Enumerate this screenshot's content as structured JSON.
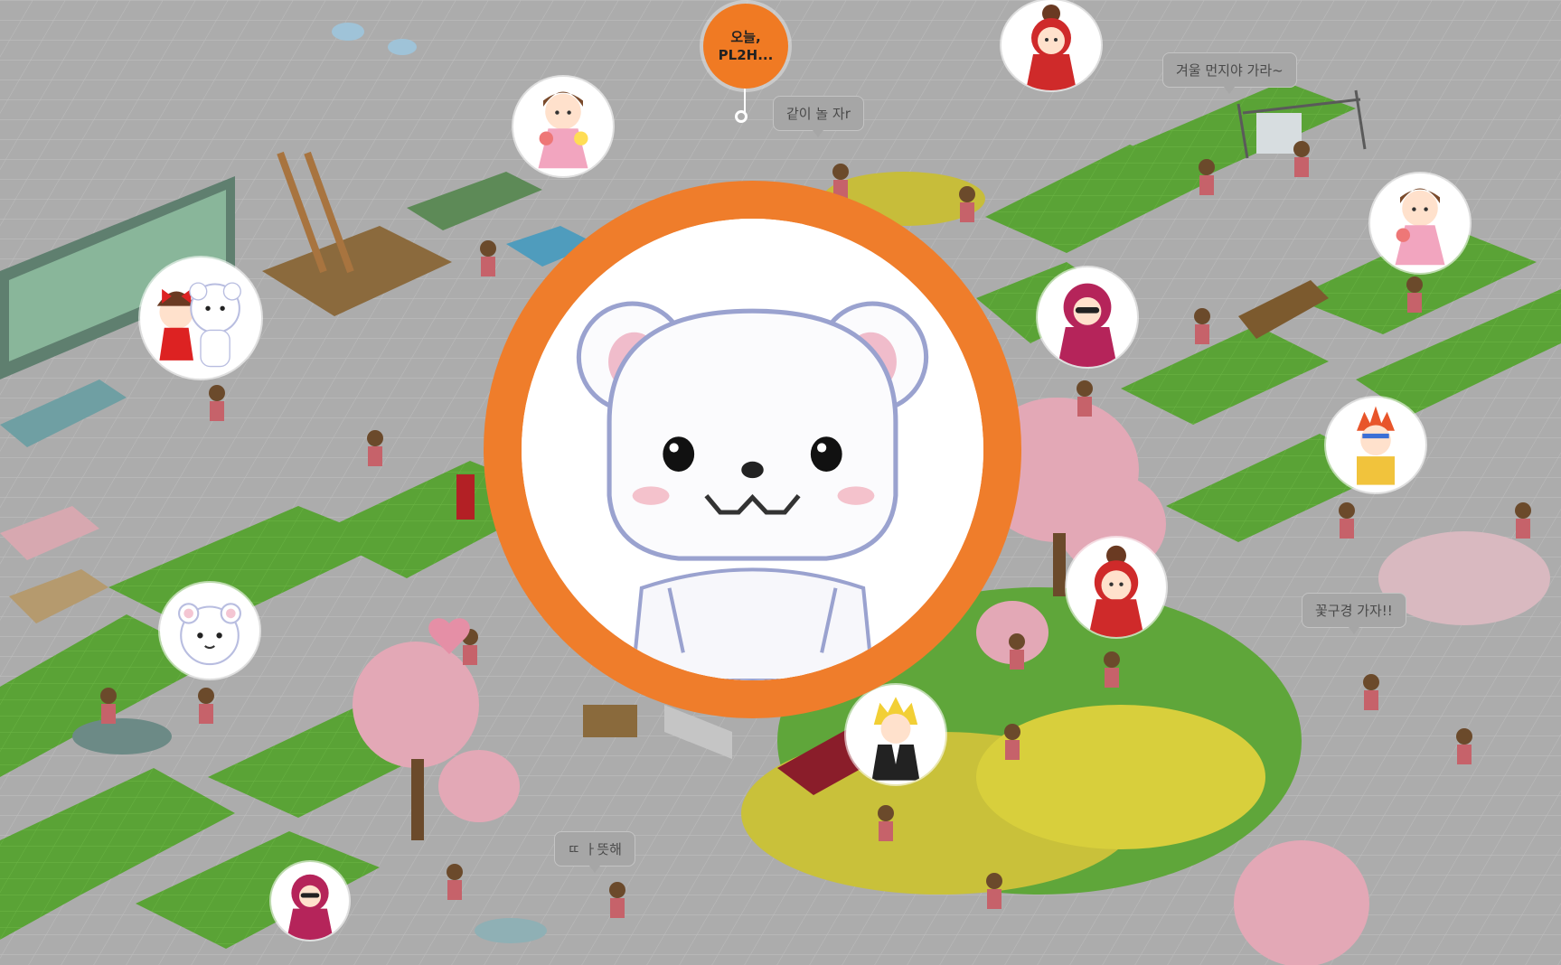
{
  "notification": {
    "label": "오늘, PL2H..."
  },
  "speech_bubbles": [
    {
      "id": "together",
      "text": "같이 놀 자r"
    },
    {
      "id": "dust",
      "text": "겨울 먼지야 가라~"
    },
    {
      "id": "flower",
      "text": "꽃구경 가자!!"
    },
    {
      "id": "warm",
      "text": "ㄸ ㅏ뜻해"
    }
  ],
  "avatars": [
    {
      "id": "featured",
      "character": "white-bear",
      "selected": true
    },
    {
      "id": "girl-flowers-1",
      "character": "girl-pink-dress"
    },
    {
      "id": "girl-red-hood-1",
      "character": "girl-red-hood"
    },
    {
      "id": "bear-and-girl",
      "character": "bear-with-girl"
    },
    {
      "id": "girl-flowers-2",
      "character": "girl-pink-dress"
    },
    {
      "id": "hijab-sunglasses-1",
      "character": "girl-hijab-sunglasses"
    },
    {
      "id": "boy-fire-hair",
      "character": "boy-flame-hair"
    },
    {
      "id": "bear-small",
      "character": "white-bear"
    },
    {
      "id": "girl-red-hood-2",
      "character": "girl-red-hood"
    },
    {
      "id": "boy-tuxedo",
      "character": "boy-blonde-tuxedo"
    },
    {
      "id": "hijab-sunglasses-2",
      "character": "girl-hijab-sunglasses"
    }
  ],
  "colors": {
    "accent": "#ef7d2b",
    "background_dim": "#9a9a9a",
    "grass": "#5fa63a",
    "tile": "#b3b3b3",
    "blossom": "#e9aebd"
  }
}
